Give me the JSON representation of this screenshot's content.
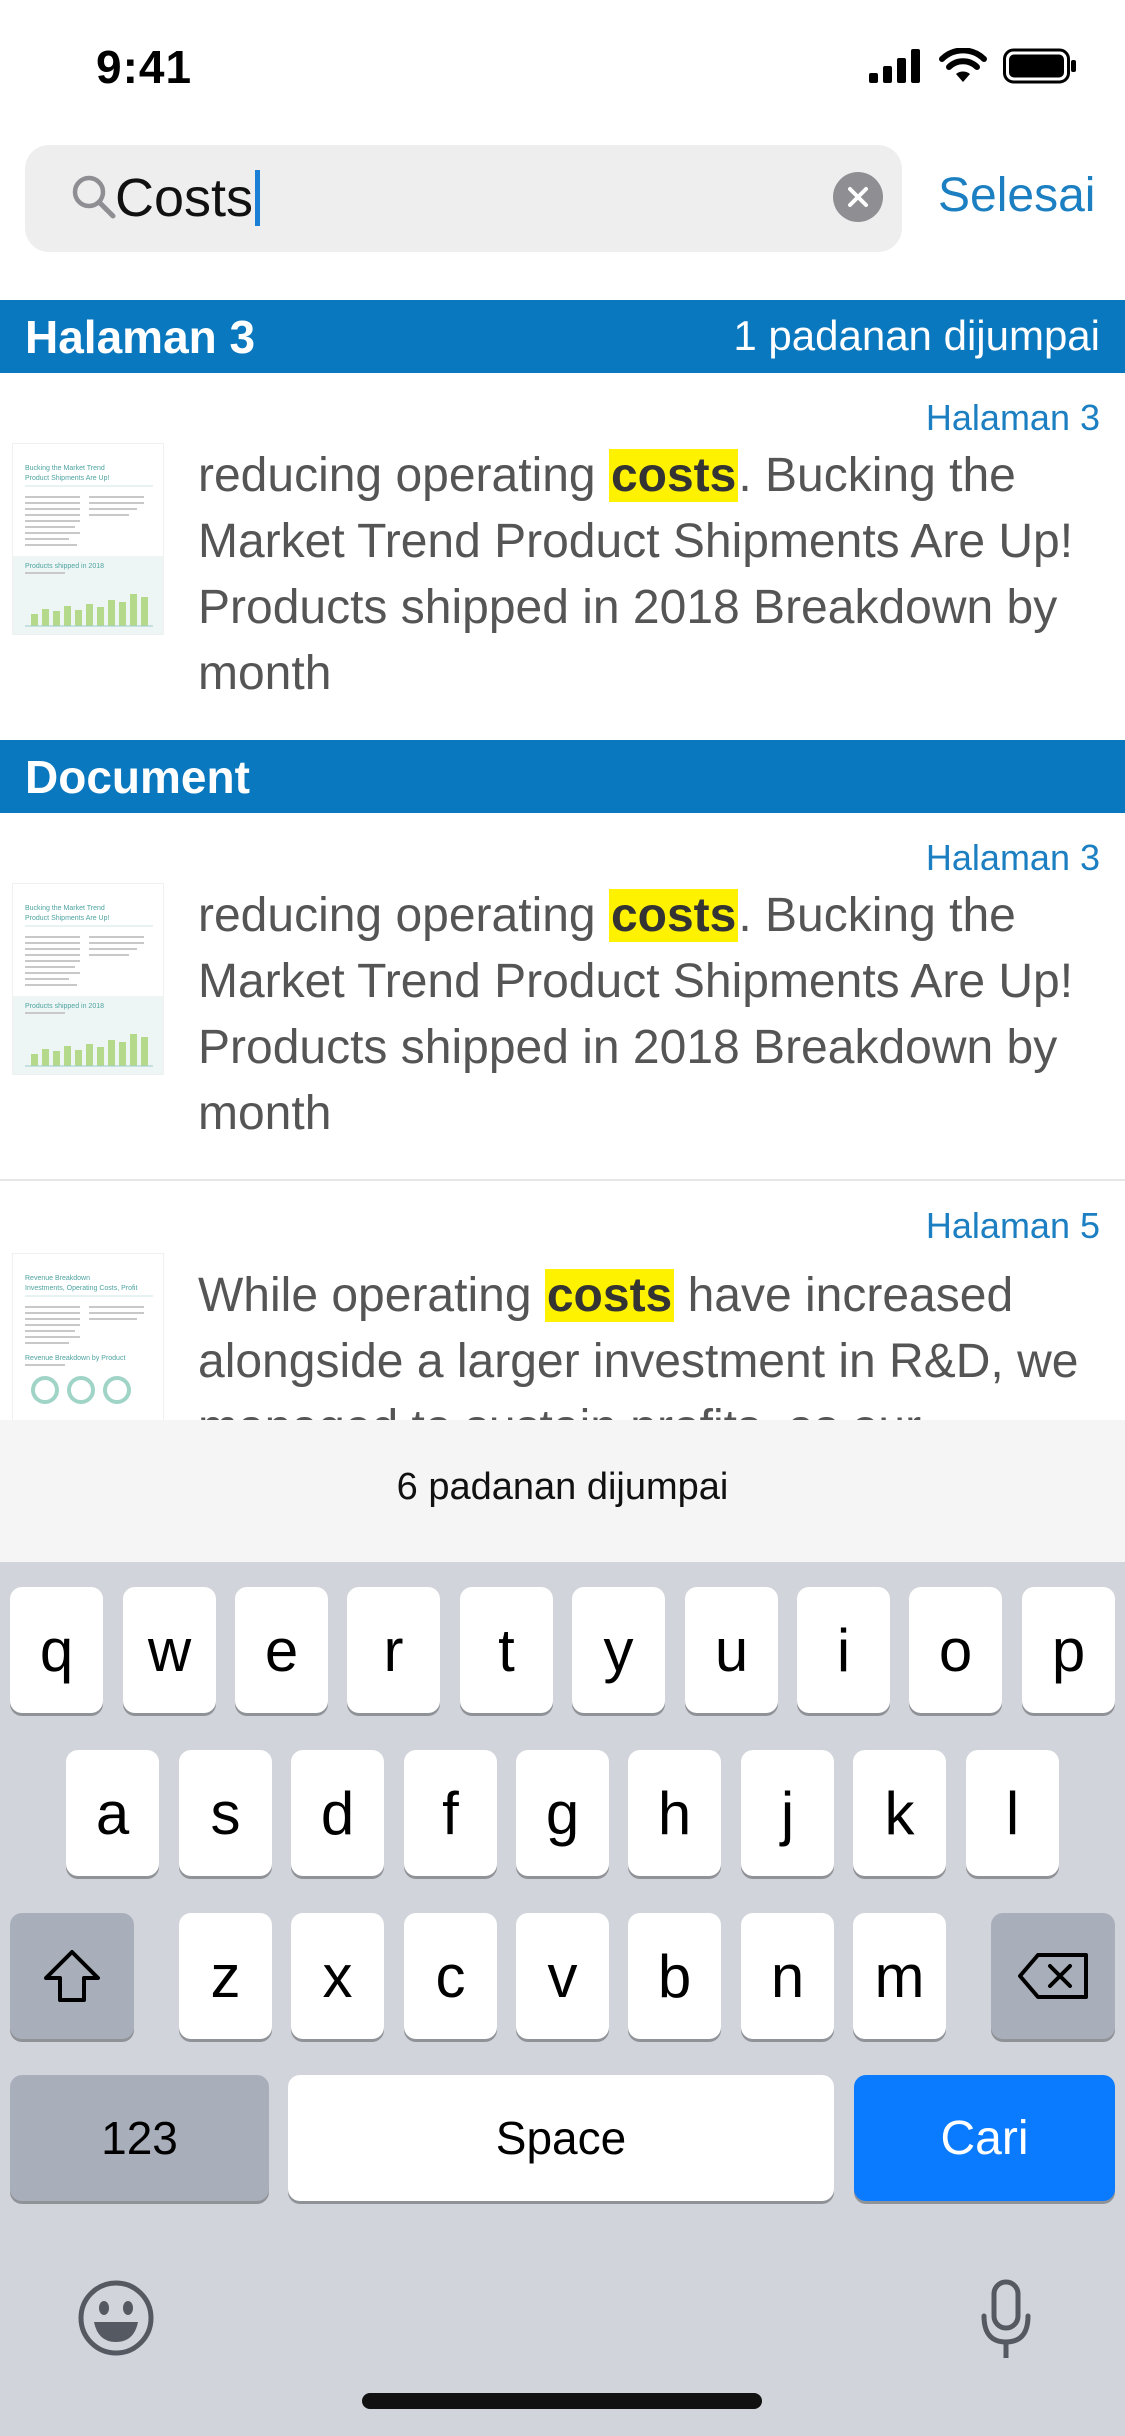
{
  "status_bar": {
    "time": "9:41"
  },
  "search": {
    "query": "Costs",
    "done_label": "Selesai"
  },
  "sections": [
    {
      "title": "Halaman 3",
      "count": "1 padanan dijumpai"
    },
    {
      "title": "Document",
      "count": ""
    }
  ],
  "results": [
    {
      "page": "Halaman 3",
      "before": "reducing operating ",
      "match": "costs",
      "after": ". Bucking the Market Trend Product Shipments Are Up! Products shipped in 2018 Breakdown by month"
    },
    {
      "page": "Halaman 3",
      "before": "reducing operating ",
      "match": "costs",
      "after": ". Bucking the Market Trend Product Shipments Are Up! Products shipped in 2018 Breakdown by month"
    },
    {
      "page": "Halaman 5",
      "before": "While operating ",
      "match": "costs",
      "after": " have increased alongside a larger investment in R&D, we managed to sustain profits, as our"
    }
  ],
  "match_bar": {
    "text": "6 padanan dijumpai"
  },
  "keyboard": {
    "row1": [
      "q",
      "w",
      "e",
      "r",
      "t",
      "y",
      "u",
      "i",
      "o",
      "p"
    ],
    "row2": [
      "a",
      "s",
      "d",
      "f",
      "g",
      "h",
      "j",
      "k",
      "l"
    ],
    "row3": [
      "z",
      "x",
      "c",
      "v",
      "b",
      "n",
      "m"
    ],
    "numbers_label": "123",
    "space_label": "Space",
    "return_label": "Cari"
  }
}
